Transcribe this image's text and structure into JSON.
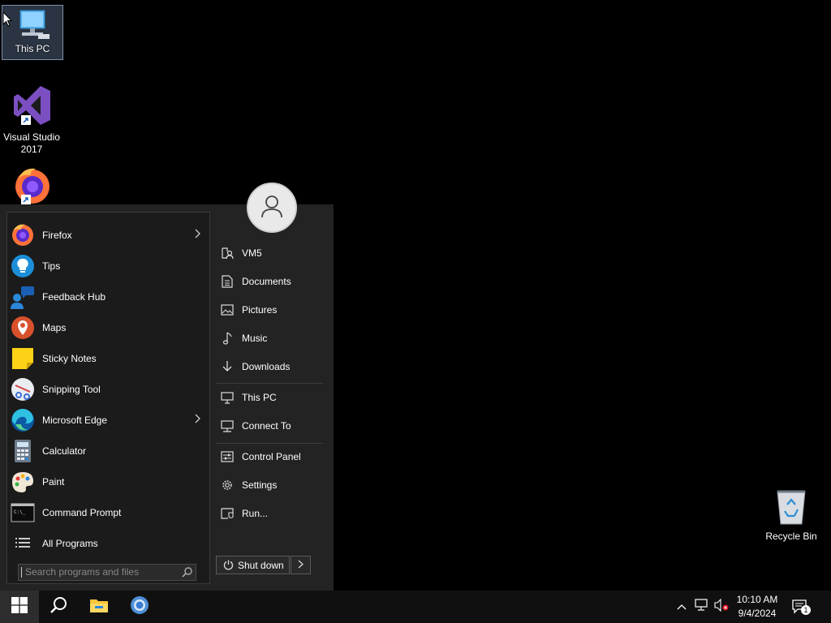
{
  "desktop": {
    "icons": [
      {
        "label": "This PC",
        "icon": "this-pc-icon"
      },
      {
        "label": "Visual Studio 2017",
        "icon": "visual-studio-icon"
      },
      {
        "label": "",
        "icon": "firefox-icon"
      },
      {
        "label": "Recycle Bin",
        "icon": "recycle-bin-icon"
      }
    ]
  },
  "start_menu": {
    "programs": [
      {
        "label": "Firefox",
        "icon": "firefox-icon",
        "has_submenu": true
      },
      {
        "label": "Tips",
        "icon": "tips-icon"
      },
      {
        "label": "Feedback Hub",
        "icon": "feedback-hub-icon"
      },
      {
        "label": "Maps",
        "icon": "maps-icon"
      },
      {
        "label": "Sticky Notes",
        "icon": "sticky-notes-icon"
      },
      {
        "label": "Snipping Tool",
        "icon": "snipping-tool-icon"
      },
      {
        "label": "Microsoft Edge",
        "icon": "edge-icon",
        "has_submenu": true
      },
      {
        "label": "Calculator",
        "icon": "calculator-icon"
      },
      {
        "label": "Paint",
        "icon": "paint-icon"
      },
      {
        "label": "Command Prompt",
        "icon": "command-prompt-icon"
      },
      {
        "label": "All Programs",
        "icon": "list-icon"
      }
    ],
    "search_placeholder": "Search programs and files",
    "places": [
      {
        "label": "VM5",
        "icon": "user-folder-icon"
      },
      {
        "label": "Documents",
        "icon": "document-icon"
      },
      {
        "label": "Pictures",
        "icon": "picture-icon"
      },
      {
        "label": "Music",
        "icon": "music-icon"
      },
      {
        "label": "Downloads",
        "icon": "download-icon"
      },
      {
        "label": "This PC",
        "icon": "computer-icon"
      },
      {
        "label": "Connect To",
        "icon": "connect-icon"
      },
      {
        "label": "Control Panel",
        "icon": "control-panel-icon"
      },
      {
        "label": "Settings",
        "icon": "gear-icon"
      },
      {
        "label": "Run...",
        "icon": "run-icon"
      }
    ],
    "shutdown_label": "Shut down"
  },
  "taskbar": {
    "items": [
      "start-icon",
      "search-icon",
      "file-explorer-icon",
      "chrome-icon"
    ],
    "tray_icons": [
      "chevron-up-icon",
      "network-icon",
      "volume-muted-icon",
      "notification-icon"
    ],
    "clock": {
      "time": "10:10 AM",
      "date": "9/4/2024"
    },
    "notification_count": "1"
  },
  "colors": {
    "accent": "#0078d7",
    "menu_bg": "#232323",
    "taskbar_bg": "#101010"
  }
}
